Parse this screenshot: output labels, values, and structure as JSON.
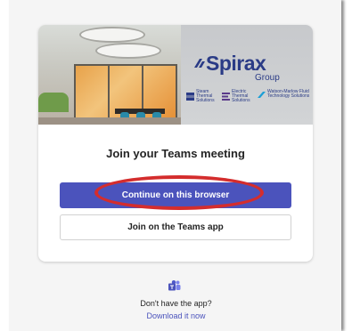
{
  "card": {
    "heading": "Join your Teams meeting",
    "continue_browser_label": "Continue on this browser",
    "join_app_label": "Join on the Teams app"
  },
  "banner": {
    "brand_name": "Spirax",
    "brand_group": "Group",
    "divisions": [
      {
        "label": "Steam Thermal Solutions",
        "icon": "steam-s-icon",
        "color": "#2a3b86"
      },
      {
        "label": "Electric Thermal Solutions",
        "icon": "electric-e-icon",
        "color": "#5a3a8a"
      },
      {
        "label": "Watson-Marlow Fluid Technology Solutions",
        "icon": "watson-marlow-icon",
        "color": "#1c9fd6"
      }
    ]
  },
  "footer": {
    "no_app_text": "Don't have the app?",
    "download_link": "Download it now",
    "icon": "teams-icon"
  },
  "colors": {
    "primary_button": "#4b53bc",
    "highlight_ellipse": "#d42d2d",
    "brand": "#2a3b86"
  }
}
